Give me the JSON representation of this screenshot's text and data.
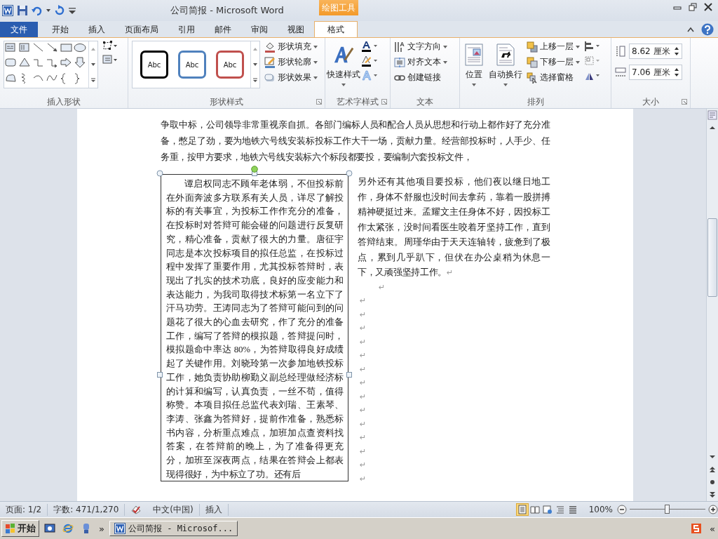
{
  "window": {
    "title": "公司简报 - Microsoft Word",
    "contextual_tab": "绘图工具"
  },
  "tabs": [
    {
      "label": "文件",
      "kind": "file",
      "selected": false
    },
    {
      "label": "开始",
      "kind": "tab",
      "selected": false
    },
    {
      "label": "插入",
      "kind": "tab",
      "selected": false
    },
    {
      "label": "页面布局",
      "kind": "tab",
      "selected": false
    },
    {
      "label": "引用",
      "kind": "tab",
      "selected": false
    },
    {
      "label": "邮件",
      "kind": "tab",
      "selected": false
    },
    {
      "label": "审阅",
      "kind": "tab",
      "selected": false
    },
    {
      "label": "视图",
      "kind": "tab",
      "selected": false
    },
    {
      "label": "格式",
      "kind": "contextual",
      "selected": true
    }
  ],
  "ribbon": {
    "insert_shapes": {
      "label": "插入形状"
    },
    "shape_styles": {
      "label": "形状样式",
      "presets": [
        {
          "text": "Abc",
          "color": "#000000"
        },
        {
          "text": "Abc",
          "color": "#4f81bd"
        },
        {
          "text": "Abc",
          "color": "#c0504d"
        }
      ],
      "commands": [
        {
          "label": "形状填充",
          "kind": "fill"
        },
        {
          "label": "形状轮廓",
          "kind": "outline"
        },
        {
          "label": "形状效果",
          "kind": "effect"
        }
      ]
    },
    "wordart_styles": {
      "label": "艺术字样式",
      "quick_styles": "快速样式"
    },
    "text": {
      "label": "文本",
      "commands": [
        {
          "label": "文字方向",
          "kind": "direction"
        },
        {
          "label": "对齐文本",
          "kind": "align"
        },
        {
          "label": "创建链接",
          "kind": "link"
        }
      ]
    },
    "arrange": {
      "label": "排列",
      "large": [
        {
          "label": "位置",
          "kind": "position"
        },
        {
          "label": "自动换行",
          "kind": "wrap"
        }
      ],
      "commands": [
        {
          "label": "上移一层",
          "kind": "forward"
        },
        {
          "label": "下移一层",
          "kind": "backward"
        },
        {
          "label": "选择窗格",
          "kind": "pane"
        }
      ]
    },
    "size": {
      "label": "大小",
      "height": "8.62 厘米",
      "width": "7.06 厘米"
    }
  },
  "document": {
    "paragraph_top": "争取中标，公司领导非常重视亲自抓。各部门编标人员和配合人员从思想和行动上都作好了充分准备，憋足了劲，要为地铁六号线安装标投标工作大干一场，贡献力量。经营部投标时，人手少、任务重，按甲方要求，地铁六号线安装标六个标段都要投，要编制六套投标文件，",
    "paragraph_side": "另外还有其他项目要投标，他们夜以继日地工作，身体不舒服也没时间去拿药，靠着一股拼搏精神硬挺过来。孟耀文主任身体不好，因投标工作太紧张，没时间看医生咬着牙坚持工作，直到答辩结束。周瑾华由于天天连轴转，疲惫到了极点，累到几乎趴下，但伏在办公桌稍为休息一下，又顽强坚持工作。",
    "end_mark": "↵",
    "text_box": "谭启权同志不顾年老体弱，不但投标前在外面奔波多方联系有关人员，详尽了解投标的有关事宜，为投标工作作充分的准备，在投标时对答辩可能会碰的问题进行反复研究，精心准备，贡献了很大的力量。唐征宇同志是本次投标项目的拟任总监，在投标过程中发挥了重要作用，尤其投标答辩时，表现出了扎实的技术功底，良好的应变能力和表达能力，为我司取得技术标第一名立下了汗马功劳。王涛同志为了答辩可能问到的问题花了很大的心血去研究，作了充分的准备工作，编写了答辩的模拟题，答辩提问时，模拟题命中率达 80%，为答辩取得良好成绩起了关键作用。刘晓玲第一次参加地铁投标工作，她负责协助柳勤义副总经理做经济标的计算和编写，认真负责，一丝不苟，值得称赞。本项目拟任总监代表刘瑞、王素琴、李涛、张鑫为答辩好，提前作准备，熟悉标书内容，分析重点难点，加班加点查资料找答案，在答辩前的晚上，为了准备得更充分，加班至深夜两点，结果在答辩会上都表现得很好，为中标立了功。还有后",
    "empty_paragraphs": [
      "↵",
      "↵",
      "↵",
      "↵",
      "↵",
      "↵",
      "↵",
      "↵",
      "↵",
      "↵",
      "↵",
      "↵",
      "↵",
      "↵",
      "↵"
    ]
  },
  "status_bar": {
    "page": "页面: 1/2",
    "words": "字数: 471/1,270",
    "language": "中文(中国)",
    "mode": "插入",
    "views": [
      {
        "kind": "print",
        "selected": true
      },
      {
        "kind": "reading",
        "selected": false
      },
      {
        "kind": "web",
        "selected": false
      },
      {
        "kind": "outline",
        "selected": false
      },
      {
        "kind": "draft",
        "selected": false
      }
    ],
    "zoom": "100%",
    "zoom_slider": {
      "level": 0.5
    }
  },
  "taskbar": {
    "start": "开始",
    "more": "»",
    "tasks": [
      {
        "label": "公司简报 - Microsof...",
        "selected": false
      }
    ],
    "tray_more": "«"
  }
}
